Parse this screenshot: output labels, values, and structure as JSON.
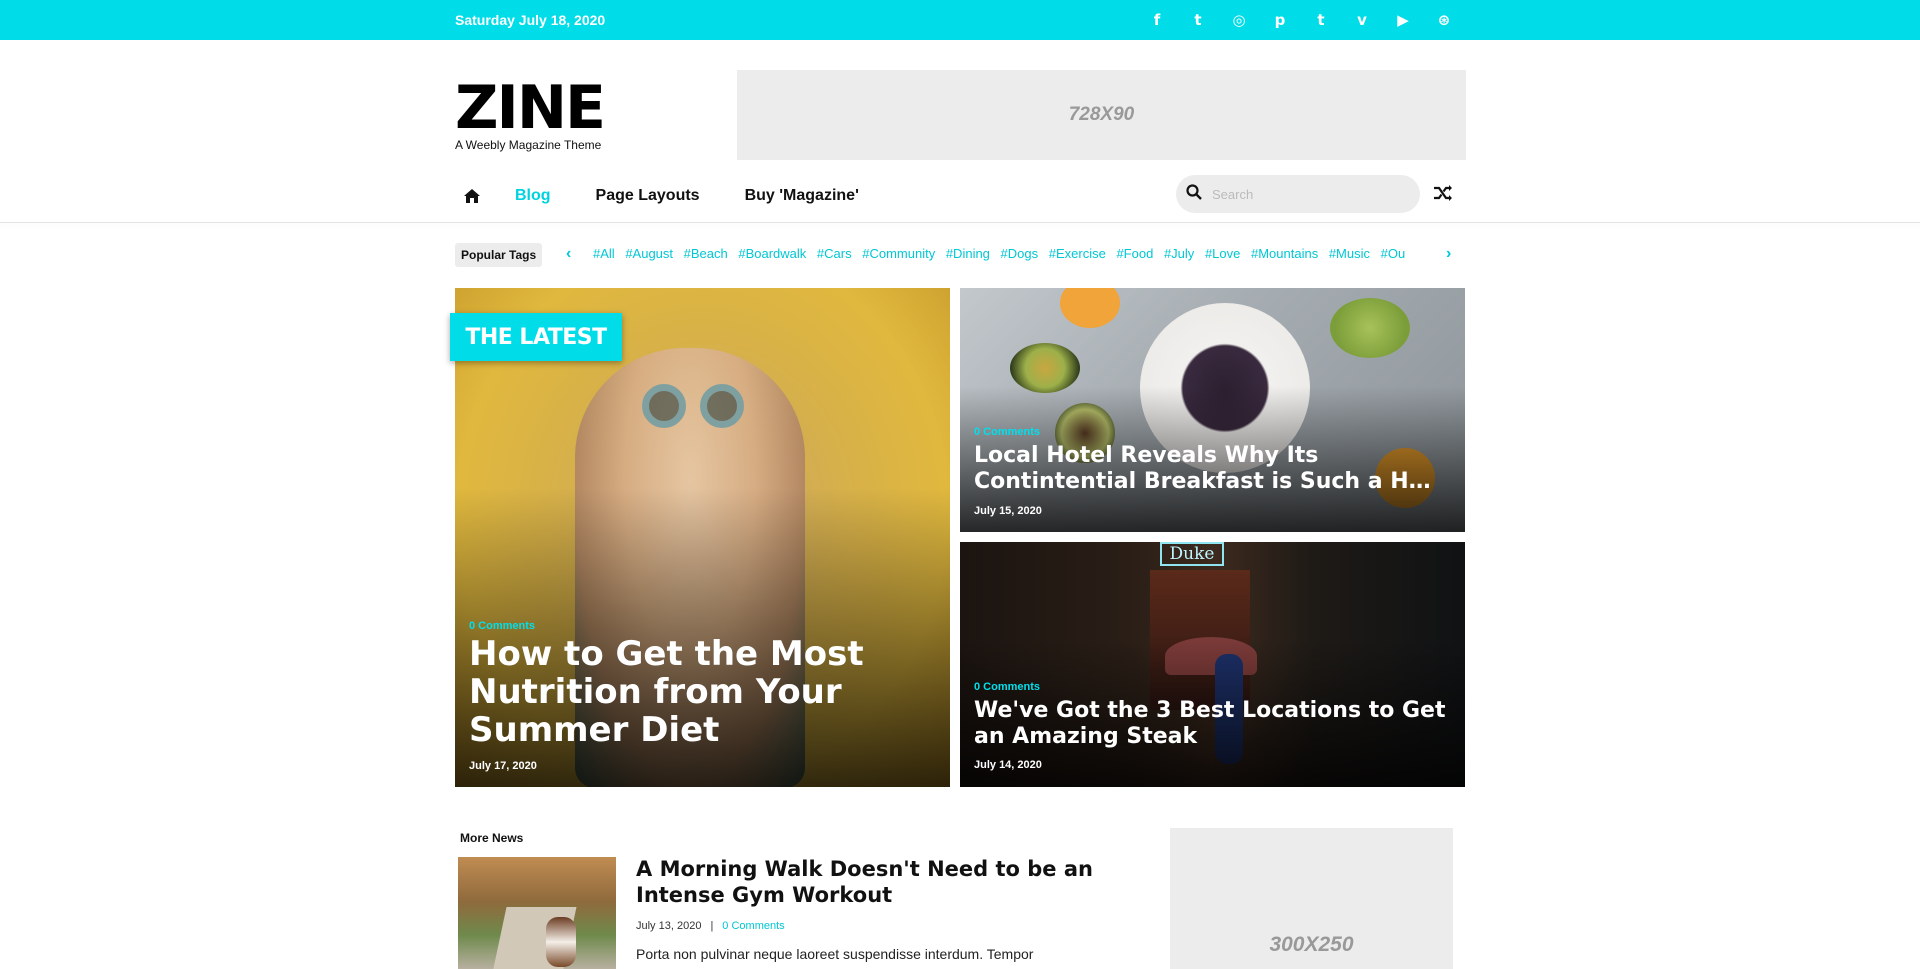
{
  "topbar": {
    "date": "Saturday July 18, 2020",
    "social_icons": [
      "facebook-icon",
      "twitter-icon",
      "instagram-icon",
      "pinterest-icon",
      "tumblr-icon",
      "vimeo-icon",
      "youtube-icon",
      "dribbble-icon"
    ],
    "social_glyphs": [
      "f",
      "t",
      "◎",
      "p",
      "t",
      "v",
      "▶",
      "⊛"
    ]
  },
  "header": {
    "logo": "ZINE",
    "tagline": "A Weebly Magazine Theme",
    "ad_label": "728X90"
  },
  "nav": {
    "items": [
      {
        "label": "Blog",
        "active": true
      },
      {
        "label": "Page Layouts",
        "active": false
      },
      {
        "label": "Buy 'Magazine'",
        "active": false
      }
    ],
    "search_placeholder": "Search"
  },
  "tags": {
    "label": "Popular Tags",
    "items": [
      "#All",
      "#August",
      "#Beach",
      "#Boardwalk",
      "#Cars",
      "#Community",
      "#Dining",
      "#Dogs",
      "#Exercise",
      "#Food",
      "#July",
      "#Love",
      "#Mountains",
      "#Music",
      "#Ou"
    ]
  },
  "featured": {
    "badge": "THE LATEST",
    "main": {
      "comments": "0 Comments",
      "title": "How to Get the Most Nutrition from Your Summer Diet",
      "date": "July 17, 2020"
    },
    "side": [
      {
        "comments": "0 Comments",
        "title_line1": "Local Hotel Reveals Why Its",
        "title_line2": "Contintential Breakfast is Such a Huge Hit",
        "date": "July 15, 2020"
      },
      {
        "comments": "0 Comments",
        "title": "We've Got the 3 Best Locations to Get an Amazing Steak",
        "date": "July 14, 2020",
        "sign": "Duke"
      }
    ]
  },
  "more_news": {
    "label": "More News",
    "article": {
      "title": "A Morning Walk Doesn't Need to be an Intense Gym Workout",
      "date": "July 13, 2020",
      "separator": "|",
      "comments": "0 Comments",
      "excerpt": "Porta non pulvinar neque laoreet suspendisse interdum. Tempor"
    },
    "ad_label": "300X250"
  },
  "colors": {
    "accent": "#00dde8",
    "link": "#00c7d4"
  }
}
